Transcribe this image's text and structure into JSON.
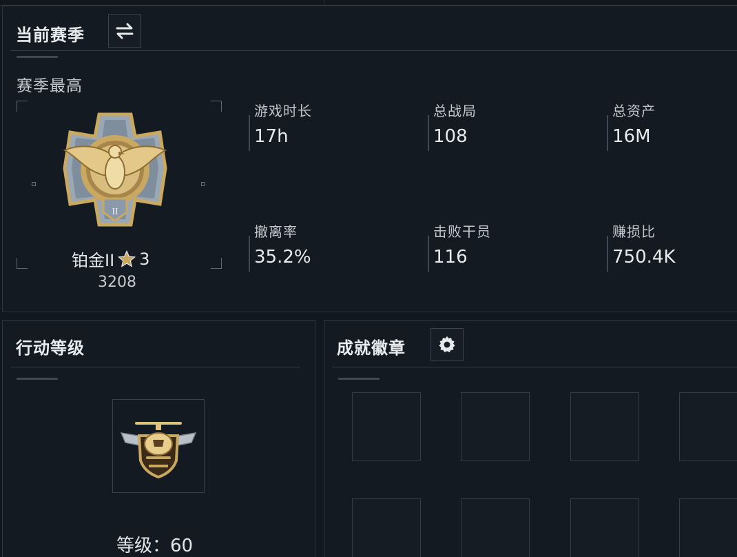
{
  "season": {
    "title": "当前赛季",
    "switch_icon": "swap-arrows-icon",
    "best_label": "赛季最高",
    "rank": {
      "name": "铂金II",
      "star_icon": "star-icon",
      "stars": "3",
      "score": "3208"
    },
    "stats": [
      {
        "label": "游戏时长",
        "value": "17h"
      },
      {
        "label": "总战局",
        "value": "108"
      },
      {
        "label": "总资产",
        "value": "16M"
      },
      {
        "label": "撤离率",
        "value": "35.2%"
      },
      {
        "label": "击败干员",
        "value": "116"
      },
      {
        "label": "赚损比",
        "value": "750.4K"
      }
    ]
  },
  "level": {
    "title": "行动等级",
    "label": "等级：60"
  },
  "achievements": {
    "title": "成就徽章",
    "settings_icon": "gear-icon"
  },
  "colors": {
    "background": "#12181f",
    "panel_border": "#2c3640",
    "text_primary": "#e8ebee",
    "gold": "#c9a862"
  }
}
